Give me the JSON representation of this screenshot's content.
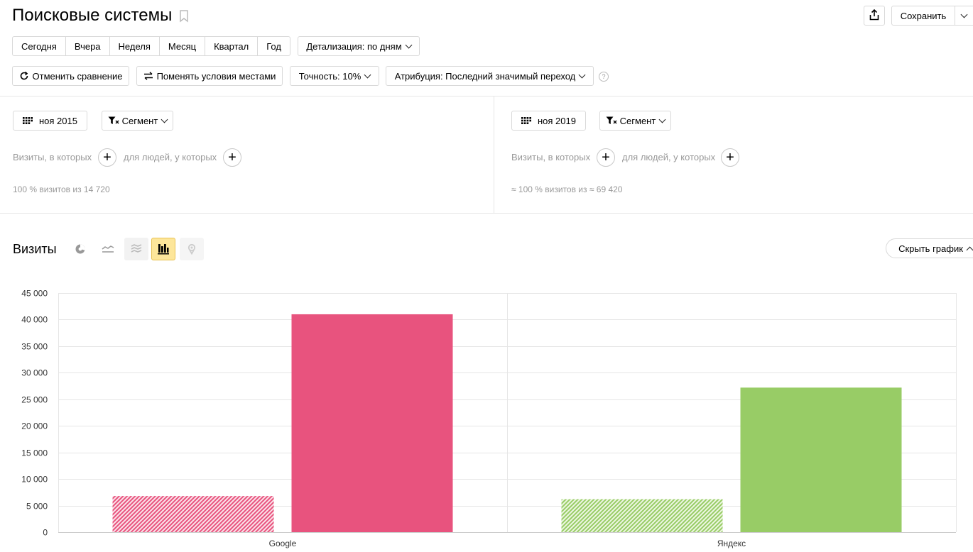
{
  "header": {
    "title": "Поисковые системы",
    "save_label": "Сохранить"
  },
  "periods": [
    "Сегодня",
    "Вчера",
    "Неделя",
    "Месяц",
    "Квартал",
    "Год"
  ],
  "detail_label": "Детализация: по дням",
  "toolbar": {
    "cancel_compare": "Отменить сравнение",
    "swap_conditions": "Поменять условия местами",
    "precision": "Точность: 10%",
    "attribution": "Атрибуция: Последний значимый переход",
    "help": "?"
  },
  "segments": {
    "left": {
      "date": "ноя 2015",
      "segment_label": "Сегмент",
      "visits_where": "Визиты, в которых",
      "people_where": "для людей, у которых",
      "summary": "100 % визитов из 14 720"
    },
    "right": {
      "date": "ноя 2019",
      "segment_label": "Сегмент",
      "visits_where": "Визиты, в которых",
      "people_where": "для людей, у которых",
      "summary": "≈ 100 % визитов из ≈ 69 420"
    }
  },
  "chart_header": {
    "title": "Визиты",
    "hide_chart": "Скрыть график"
  },
  "colors": {
    "google": "#e8537e",
    "yandex": "#98cc66",
    "active_view_bg": "#fde69a"
  },
  "chart_data": {
    "type": "bar",
    "categories": [
      "Google",
      "Яндекс"
    ],
    "series": [
      {
        "values": [
          6800,
          6200
        ],
        "pattern": "hatched"
      },
      {
        "values": [
          41000,
          27200
        ],
        "pattern": "solid"
      }
    ],
    "ylim": [
      0,
      45000
    ],
    "yticks": [
      "0",
      "5 000",
      "10 000",
      "15 000",
      "20 000",
      "25 000",
      "30 000",
      "35 000",
      "40 000",
      "45 000"
    ],
    "yticks_values": [
      0,
      5000,
      10000,
      15000,
      20000,
      25000,
      30000,
      35000,
      40000,
      45000
    ],
    "grid": true,
    "legend": "none"
  }
}
